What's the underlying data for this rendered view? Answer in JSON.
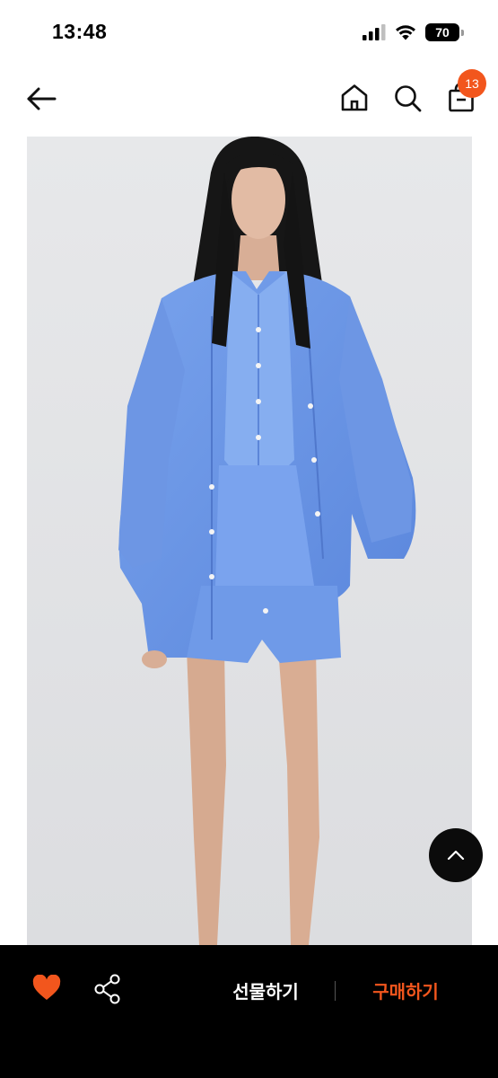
{
  "status_bar": {
    "time": "13:48",
    "battery": "70",
    "icons": [
      "signal-icon",
      "wifi-icon",
      "battery-icon"
    ]
  },
  "header": {
    "icons": [
      "back-arrow-icon",
      "home-icon",
      "search-icon",
      "shopping-bag-icon"
    ],
    "cart_count": "13",
    "badge_color": "#f2561d"
  },
  "product_image": {
    "subject": "model wearing blue oversized shirt over blue shirt, blue skirt and shorts",
    "background_color": "#e4e5e7",
    "garment_color": "#6b97e6"
  },
  "scroll_top": {
    "icon": "chevron-up-icon"
  },
  "bottom_bar": {
    "like_icon": "heart-icon",
    "share_icon": "share-icon",
    "gift_label": "선물하기",
    "buy_label": "구매하기",
    "accent_color": "#f2561d"
  }
}
